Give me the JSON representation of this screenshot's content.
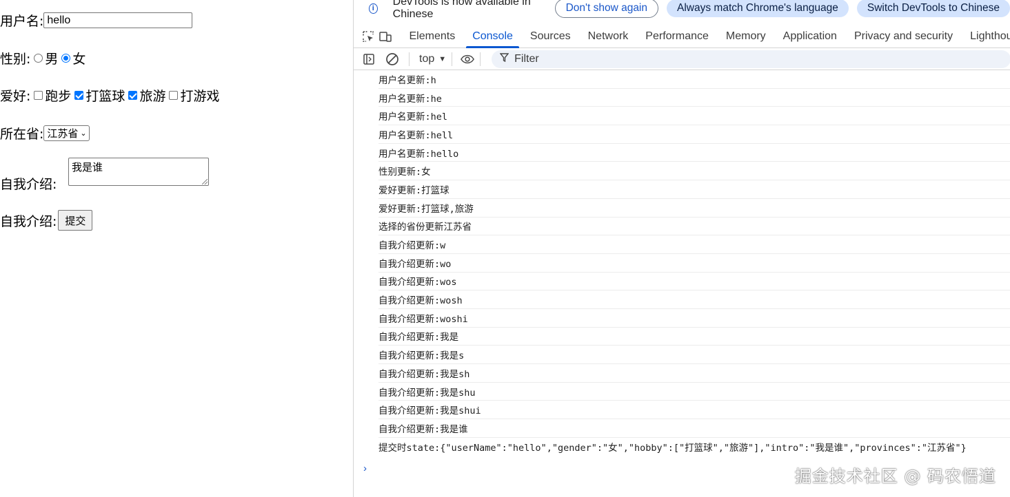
{
  "form": {
    "username_label": "用户名:",
    "username_value": "hello",
    "gender_label": "性别:",
    "gender_options": [
      "男",
      "女"
    ],
    "gender_selected": "女",
    "hobby_label": "爱好:",
    "hobbies": [
      {
        "label": "跑步",
        "checked": false
      },
      {
        "label": "打篮球",
        "checked": true
      },
      {
        "label": "旅游",
        "checked": true
      },
      {
        "label": "打游戏",
        "checked": false
      }
    ],
    "province_label": "所在省:",
    "province_value": "江苏省",
    "intro_label": "自我介绍:",
    "intro_value": "我是谁",
    "submit_row_label": "自我介绍:",
    "submit_label": "提交"
  },
  "devtools": {
    "infobar": {
      "message": "DevTools is now available in Chinese",
      "dont_show": "Don't show again",
      "match_lang": "Always match Chrome's language",
      "switch": "Switch DevTools to Chinese"
    },
    "tabs": [
      "Elements",
      "Console",
      "Sources",
      "Network",
      "Performance",
      "Memory",
      "Application",
      "Privacy and security",
      "Lighthouse"
    ],
    "active_tab": "Console",
    "context": "top",
    "filter_placeholder": "Filter",
    "logs": [
      "用户名更新:h",
      "用户名更新:he",
      "用户名更新:hel",
      "用户名更新:hell",
      "用户名更新:hello",
      "性别更新:女",
      "爱好更新:打篮球",
      "爱好更新:打篮球,旅游",
      "选择的省份更新江苏省",
      "自我介绍更新:w",
      "自我介绍更新:wo",
      "自我介绍更新:wos",
      "自我介绍更新:wosh",
      "自我介绍更新:woshi",
      "自我介绍更新:我是",
      "自我介绍更新:我是s",
      "自我介绍更新:我是sh",
      "自我介绍更新:我是shu",
      "自我介绍更新:我是shui",
      "自我介绍更新:我是谁",
      "提交时state:{\"userName\":\"hello\",\"gender\":\"女\",\"hobby\":[\"打篮球\",\"旅游\"],\"intro\":\"我是谁\",\"provinces\":\"江苏省\"}"
    ]
  },
  "watermark": "掘金技术社区 @ 码农悟道",
  "colors": {
    "accent": "#0b57d0",
    "checkbox": "#0075ff",
    "pill_fill": "#d3e3fd"
  }
}
